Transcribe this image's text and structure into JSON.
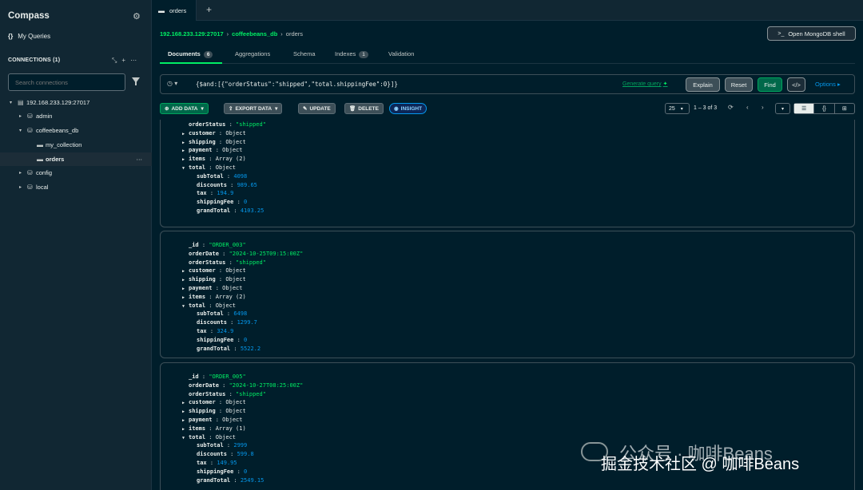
{
  "app": {
    "title": "Compass",
    "my_queries": "My Queries",
    "connections_label": "CONNECTIONS (1)",
    "search_placeholder": "Search connections"
  },
  "tree": [
    {
      "label": "192.168.233.129:27017",
      "icon": "server-icon",
      "indent": 0,
      "arrow": "▾"
    },
    {
      "label": "admin",
      "icon": "database-icon",
      "indent": 1,
      "arrow": "▸"
    },
    {
      "label": "coffeebeans_db",
      "icon": "database-icon",
      "indent": 1,
      "arrow": "▾"
    },
    {
      "label": "my_collection",
      "icon": "folder-icon",
      "indent": 2,
      "arrow": ""
    },
    {
      "label": "orders",
      "icon": "folder-icon",
      "indent": 2,
      "arrow": "",
      "selected": true
    },
    {
      "label": "config",
      "icon": "database-icon",
      "indent": 1,
      "arrow": "▸"
    },
    {
      "label": "local",
      "icon": "database-icon",
      "indent": 1,
      "arrow": "▸"
    }
  ],
  "tab": {
    "label": "orders"
  },
  "breadcrumb": {
    "host": "192.168.233.129:27017",
    "db": "coffeebeans_db",
    "collection": "orders"
  },
  "shell_button": "Open MongoDB shell",
  "subtabs": [
    {
      "label": "Documents",
      "badge": "6",
      "active": true
    },
    {
      "label": "Aggregations"
    },
    {
      "label": "Schema"
    },
    {
      "label": "Indexes",
      "badge": "1"
    },
    {
      "label": "Validation"
    }
  ],
  "query": {
    "text": "{$and:[{\"orderStatus\":\"shipped\",\"total.shippingFee\":0}]}",
    "generate": "Generate query",
    "explain": "Explain",
    "reset": "Reset",
    "find": "Find",
    "options": "Options"
  },
  "toolbar": {
    "add": "ADD DATA",
    "export": "EXPORT DATA",
    "update": "UPDATE",
    "delete": "DELETE",
    "insight": "INSIGHT",
    "page_size": "25",
    "range": "1 – 3 of 3"
  },
  "documents": [
    {
      "fields": [
        {
          "k": "orderStatus",
          "v": "\"shipped\"",
          "t": "str"
        },
        {
          "k": "customer",
          "v": "Object",
          "t": "typ",
          "exp": true
        },
        {
          "k": "shipping",
          "v": "Object",
          "t": "typ",
          "exp": true
        },
        {
          "k": "payment",
          "v": "Object",
          "t": "typ",
          "exp": true
        },
        {
          "k": "items",
          "v": "Array (2)",
          "t": "typ",
          "exp": true
        },
        {
          "k": "total",
          "v": "Object",
          "t": "typ",
          "open": true
        },
        {
          "k": "subTotal",
          "v": "4098",
          "t": "num",
          "sub": true
        },
        {
          "k": "discounts",
          "v": "989.65",
          "t": "num",
          "sub": true
        },
        {
          "k": "tax",
          "v": "194.9",
          "t": "num",
          "sub": true
        },
        {
          "k": "shippingFee",
          "v": "0",
          "t": "num",
          "sub": true
        },
        {
          "k": "grandTotal",
          "v": "4103.25",
          "t": "num",
          "sub": true
        }
      ]
    },
    {
      "fields": [
        {
          "k": "_id",
          "v": "\"ORDER_003\"",
          "t": "str"
        },
        {
          "k": "orderDate",
          "v": "\"2024-10-25T09:15:00Z\"",
          "t": "str"
        },
        {
          "k": "orderStatus",
          "v": "\"shipped\"",
          "t": "str"
        },
        {
          "k": "customer",
          "v": "Object",
          "t": "typ",
          "exp": true
        },
        {
          "k": "shipping",
          "v": "Object",
          "t": "typ",
          "exp": true
        },
        {
          "k": "payment",
          "v": "Object",
          "t": "typ",
          "exp": true
        },
        {
          "k": "items",
          "v": "Array (2)",
          "t": "typ",
          "exp": true
        },
        {
          "k": "total",
          "v": "Object",
          "t": "typ",
          "open": true
        },
        {
          "k": "subTotal",
          "v": "6498",
          "t": "num",
          "sub": true
        },
        {
          "k": "discounts",
          "v": "1299.7",
          "t": "num",
          "sub": true
        },
        {
          "k": "tax",
          "v": "324.9",
          "t": "num",
          "sub": true
        },
        {
          "k": "shippingFee",
          "v": "0",
          "t": "num",
          "sub": true
        },
        {
          "k": "grandTotal",
          "v": "5522.2",
          "t": "num",
          "sub": true
        }
      ]
    },
    {
      "fields": [
        {
          "k": "_id",
          "v": "\"ORDER_005\"",
          "t": "str"
        },
        {
          "k": "orderDate",
          "v": "\"2024-10-27T08:25:00Z\"",
          "t": "str"
        },
        {
          "k": "orderStatus",
          "v": "\"shipped\"",
          "t": "str"
        },
        {
          "k": "customer",
          "v": "Object",
          "t": "typ",
          "exp": true
        },
        {
          "k": "shipping",
          "v": "Object",
          "t": "typ",
          "exp": true
        },
        {
          "k": "payment",
          "v": "Object",
          "t": "typ",
          "exp": true
        },
        {
          "k": "items",
          "v": "Array (1)",
          "t": "typ",
          "exp": true
        },
        {
          "k": "total",
          "v": "Object",
          "t": "typ",
          "open": true
        },
        {
          "k": "subTotal",
          "v": "2999",
          "t": "num",
          "sub": true
        },
        {
          "k": "discounts",
          "v": "599.8",
          "t": "num",
          "sub": true
        },
        {
          "k": "tax",
          "v": "149.95",
          "t": "num",
          "sub": true
        },
        {
          "k": "shippingFee",
          "v": "0",
          "t": "num",
          "sub": true
        },
        {
          "k": "grandTotal",
          "v": "2549.15",
          "t": "num",
          "sub": true
        }
      ]
    }
  ],
  "watermark": {
    "line1": "公众号 · 咖啡Beans",
    "line2": "掘金技术社区 @ 咖啡Beans"
  }
}
